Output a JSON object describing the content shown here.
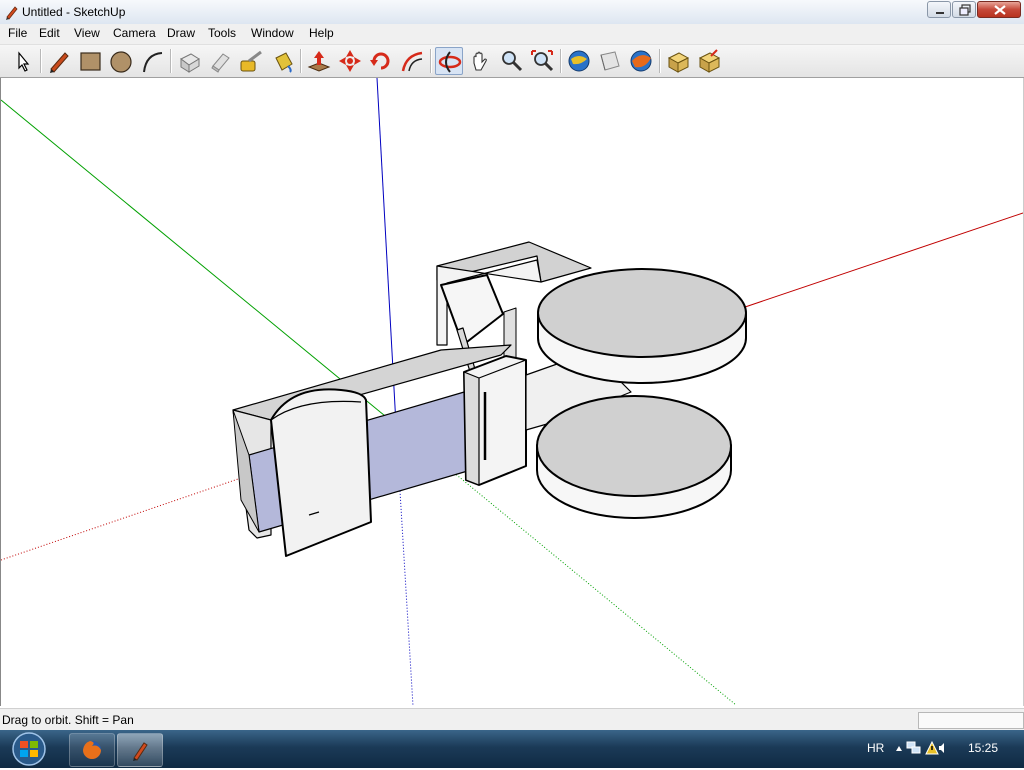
{
  "window": {
    "title": "Untitled - SketchUp"
  },
  "menu": {
    "file": "File",
    "edit": "Edit",
    "view": "View",
    "camera": "Camera",
    "draw": "Draw",
    "tools": "Tools",
    "window": "Window",
    "help": "Help"
  },
  "toolbar": {
    "tools": [
      "select-icon",
      "pencil-icon",
      "rectangle-icon",
      "circle-icon",
      "arc-icon",
      "make-component-icon",
      "eraser-icon",
      "tape-measure-icon",
      "paint-bucket-icon",
      "push-pull-icon",
      "move-icon",
      "rotate-icon",
      "offset-icon",
      "orbit-icon",
      "pan-icon",
      "zoom-icon",
      "zoom-extents-icon",
      "get-models-icon",
      "share-model-icon",
      "google-earth-icon",
      "component-warehouse-icon",
      "share-component-icon"
    ],
    "active_tool": "orbit-icon"
  },
  "status": {
    "hint": "Drag to orbit.  Shift = Pan",
    "measurement": ""
  },
  "taskbar": {
    "language": "HR",
    "clock": "15:25",
    "apps": [
      "firefox-icon",
      "sketchup-icon"
    ]
  },
  "colors": {
    "axis_red": "#c00000",
    "axis_green": "#00a000",
    "axis_blue": "#0000c0",
    "face": "#f5f5f5",
    "face_shade": "#d2d2d2",
    "back_face": "#b0b4d6"
  }
}
